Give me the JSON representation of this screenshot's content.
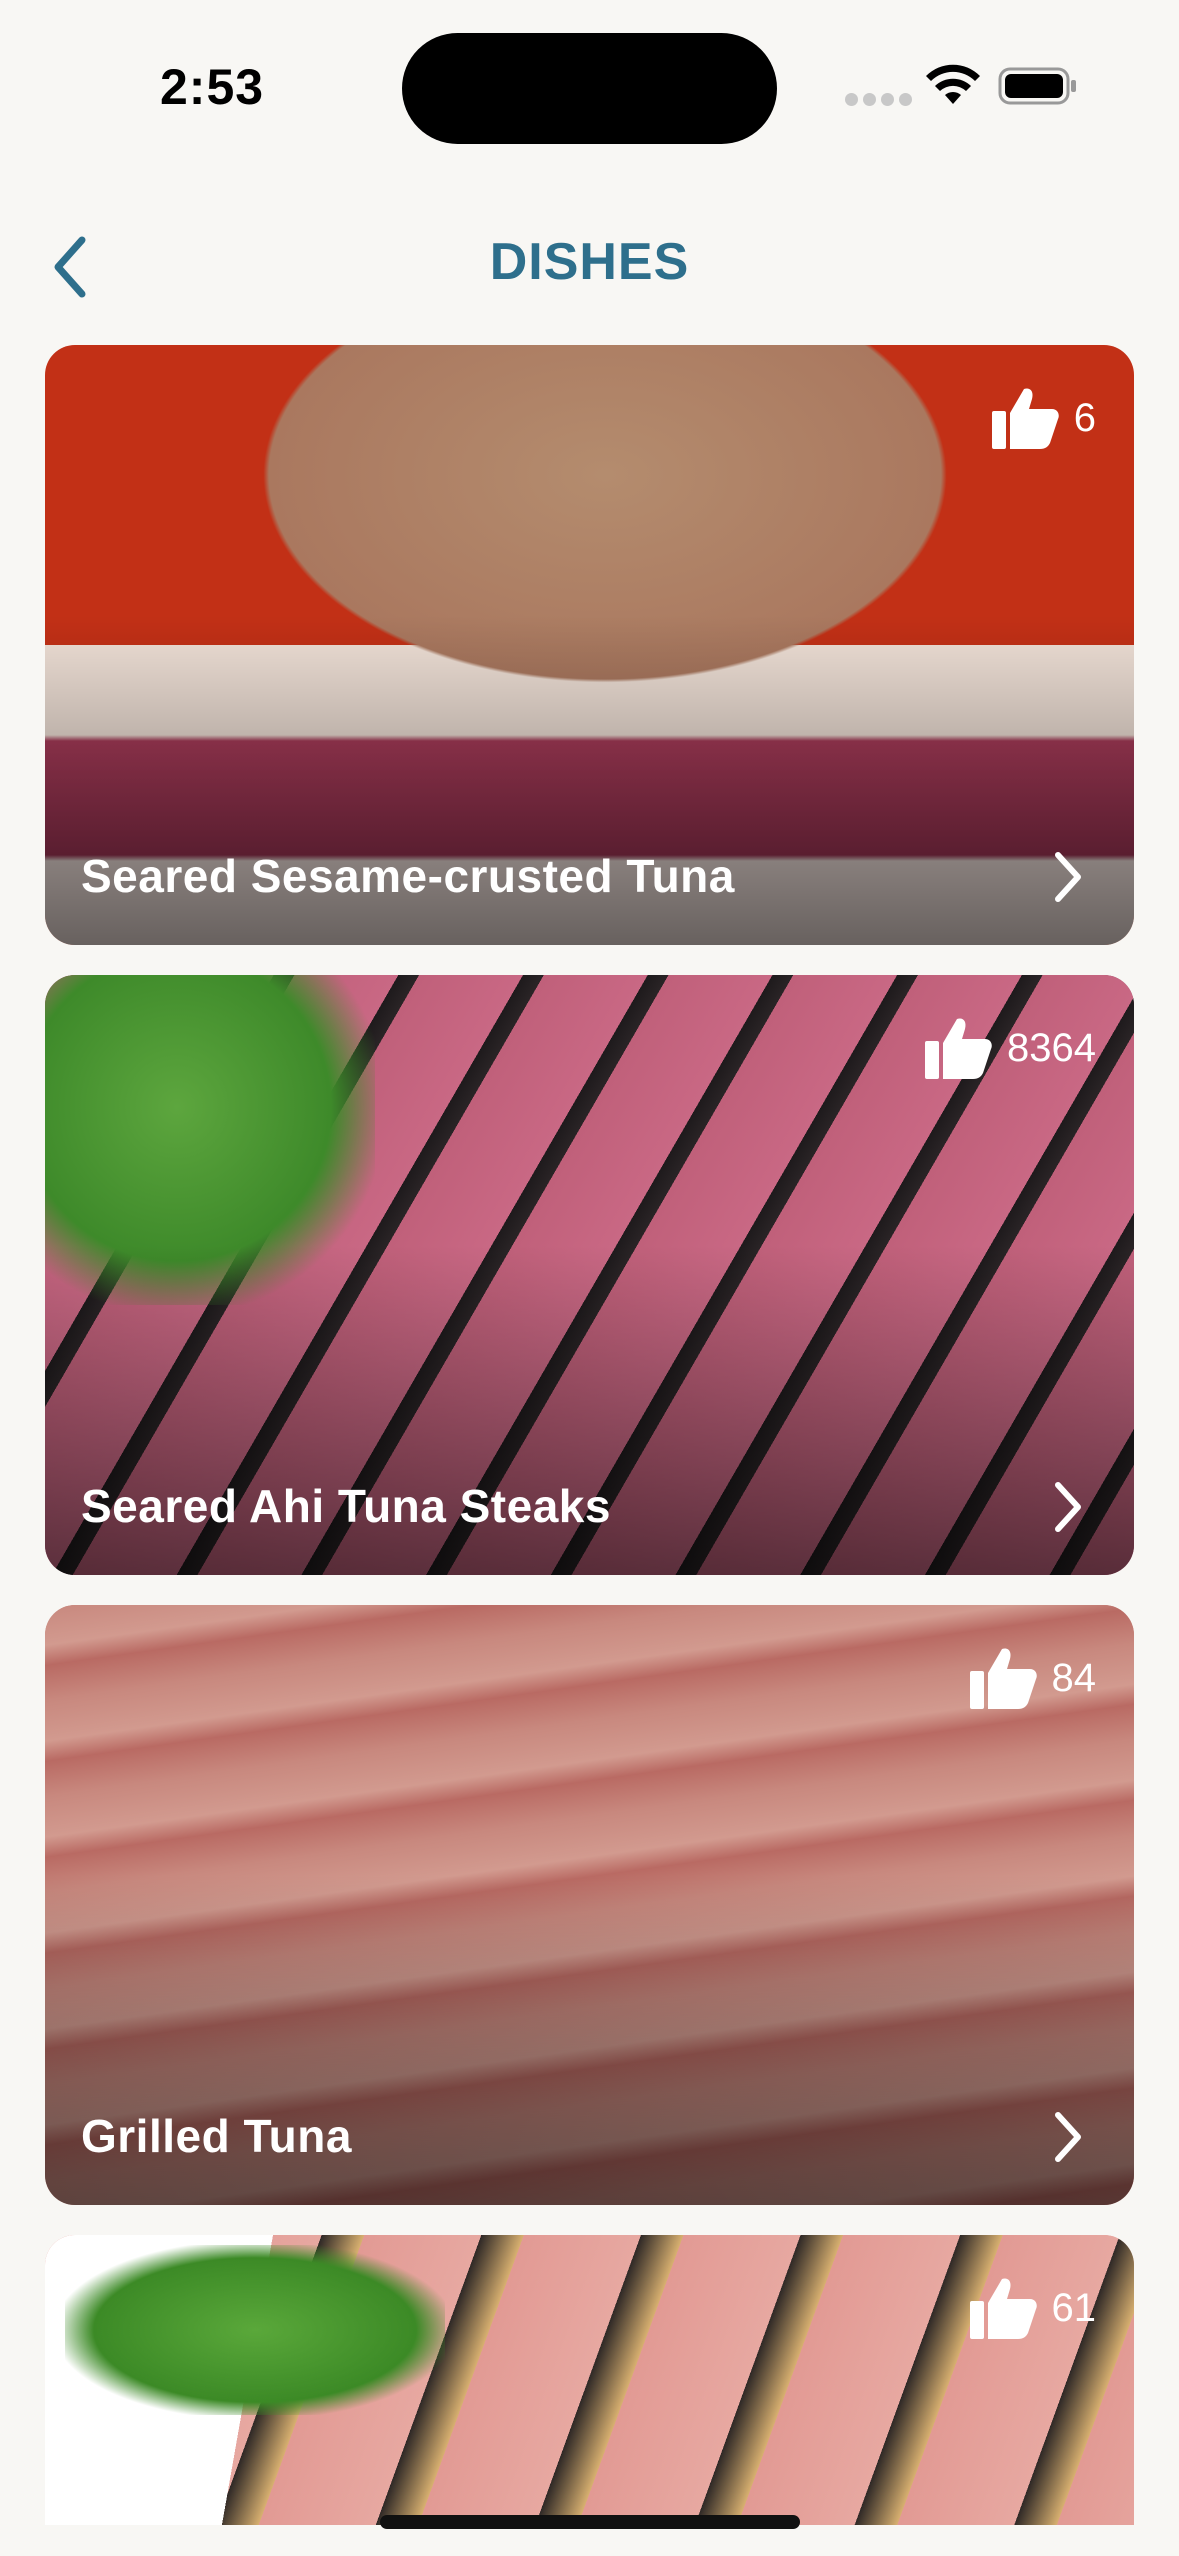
{
  "status_bar": {
    "time": "2:53"
  },
  "nav": {
    "title": "DISHES",
    "back_icon": "chevron-left-icon",
    "accent_color": "#2e6f8c"
  },
  "dishes": [
    {
      "name": "Seared Sesame-crusted Tuna",
      "likes": "6"
    },
    {
      "name": "Seared Ahi Tuna Steaks",
      "likes": "8364"
    },
    {
      "name": "Grilled Tuna",
      "likes": "84"
    },
    {
      "name": "",
      "likes": "61"
    }
  ],
  "icons": {
    "like": "thumbs-up-icon",
    "open": "chevron-right-icon"
  }
}
